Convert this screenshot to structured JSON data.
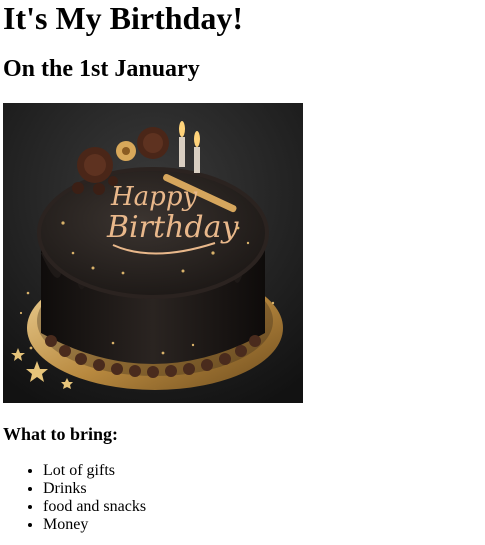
{
  "page": {
    "title": "It's My Birthday!",
    "subtitle": "On the 1st January"
  },
  "image": {
    "lettering_1": "Happy",
    "lettering_2": "Birthday"
  },
  "bring": {
    "heading": "What to bring:",
    "items": [
      "Lot of gifts",
      "Drinks",
      "food and snacks",
      "Money"
    ]
  },
  "colors": {
    "cake_dark": "#1a1614",
    "gold": "#c9a26a",
    "board_gold": "#b8893f",
    "lettering": "#e9b88b"
  }
}
